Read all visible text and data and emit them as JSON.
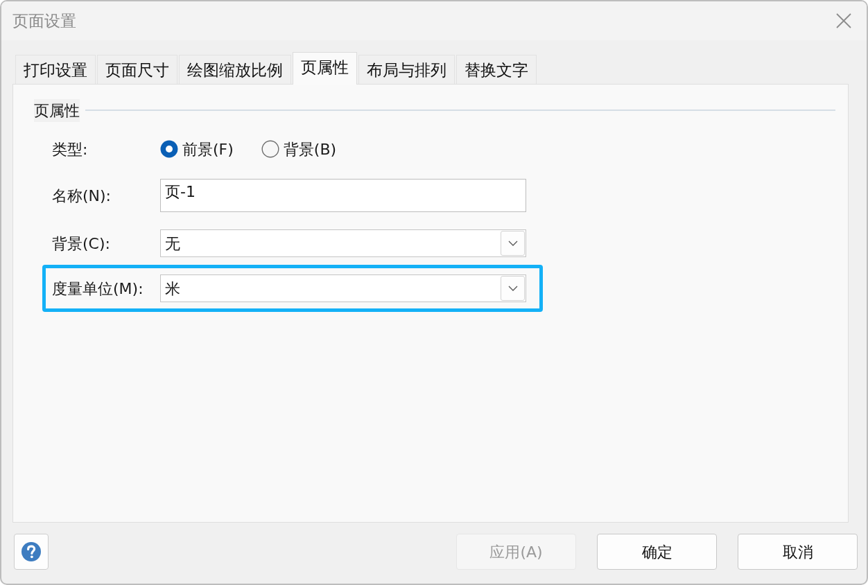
{
  "window": {
    "title": "页面设置"
  },
  "tabs": [
    {
      "label": "打印设置",
      "selected": false
    },
    {
      "label": "页面尺寸",
      "selected": false
    },
    {
      "label": "绘图缩放比例",
      "selected": false
    },
    {
      "label": "页属性",
      "selected": true
    },
    {
      "label": "布局与排列",
      "selected": false
    },
    {
      "label": "替换文字",
      "selected": false
    }
  ],
  "group": {
    "title": "页属性",
    "fields": [
      {
        "kind": "radio",
        "label": "类型:",
        "highlighted": false,
        "options": [
          {
            "label": "前景(F)",
            "selected": true
          },
          {
            "label": "背景(B)",
            "selected": false
          }
        ]
      },
      {
        "kind": "text",
        "label": "名称(N):",
        "value": "页-1",
        "highlighted": false
      },
      {
        "kind": "select",
        "label": "背景(C):",
        "value": "无",
        "highlighted": false
      },
      {
        "kind": "select",
        "label": "度量单位(M):",
        "value": "米",
        "highlighted": true
      }
    ]
  },
  "buttons": [
    {
      "kind": "help"
    },
    {
      "kind": "text",
      "label": "应用(A)",
      "disabled": true
    },
    {
      "kind": "text",
      "label": "确定",
      "disabled": false
    },
    {
      "kind": "text",
      "label": "取消",
      "disabled": false
    }
  ]
}
